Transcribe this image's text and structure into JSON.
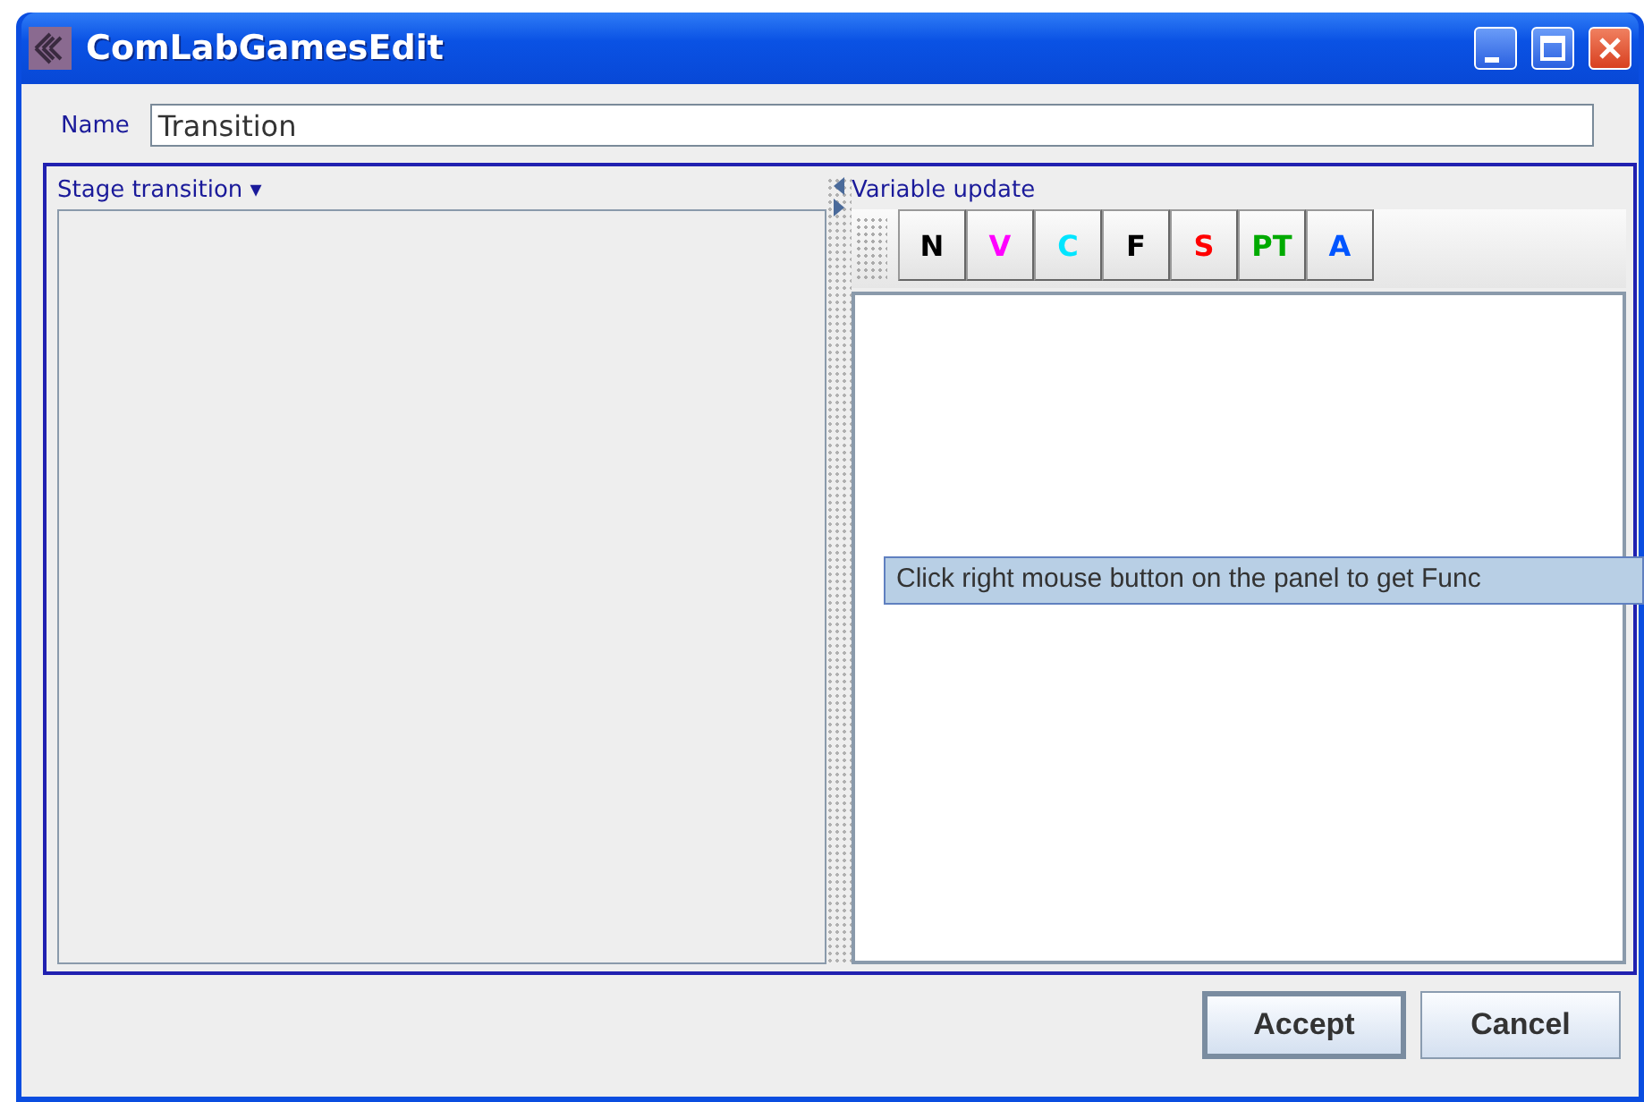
{
  "window": {
    "title": "ComLabGamesEdit"
  },
  "name_field": {
    "label": "Name",
    "value": "Transition"
  },
  "left_panel": {
    "title": "Stage transition ▾"
  },
  "right_panel": {
    "title": "Variable update",
    "toolbar": [
      {
        "label": "N",
        "color": "#000000"
      },
      {
        "label": "V",
        "color": "#ff00ff"
      },
      {
        "label": "C",
        "color": "#00e5ff"
      },
      {
        "label": "F",
        "color": "#000000"
      },
      {
        "label": "S",
        "color": "#ff0000"
      },
      {
        "label": "PT",
        "color": "#00aa00"
      },
      {
        "label": "A",
        "color": "#0055ff"
      }
    ]
  },
  "tooltip": "Click right mouse button on the panel to get Func",
  "buttons": [
    {
      "label": "Accept",
      "default": true
    },
    {
      "label": "Cancel",
      "default": false
    }
  ]
}
